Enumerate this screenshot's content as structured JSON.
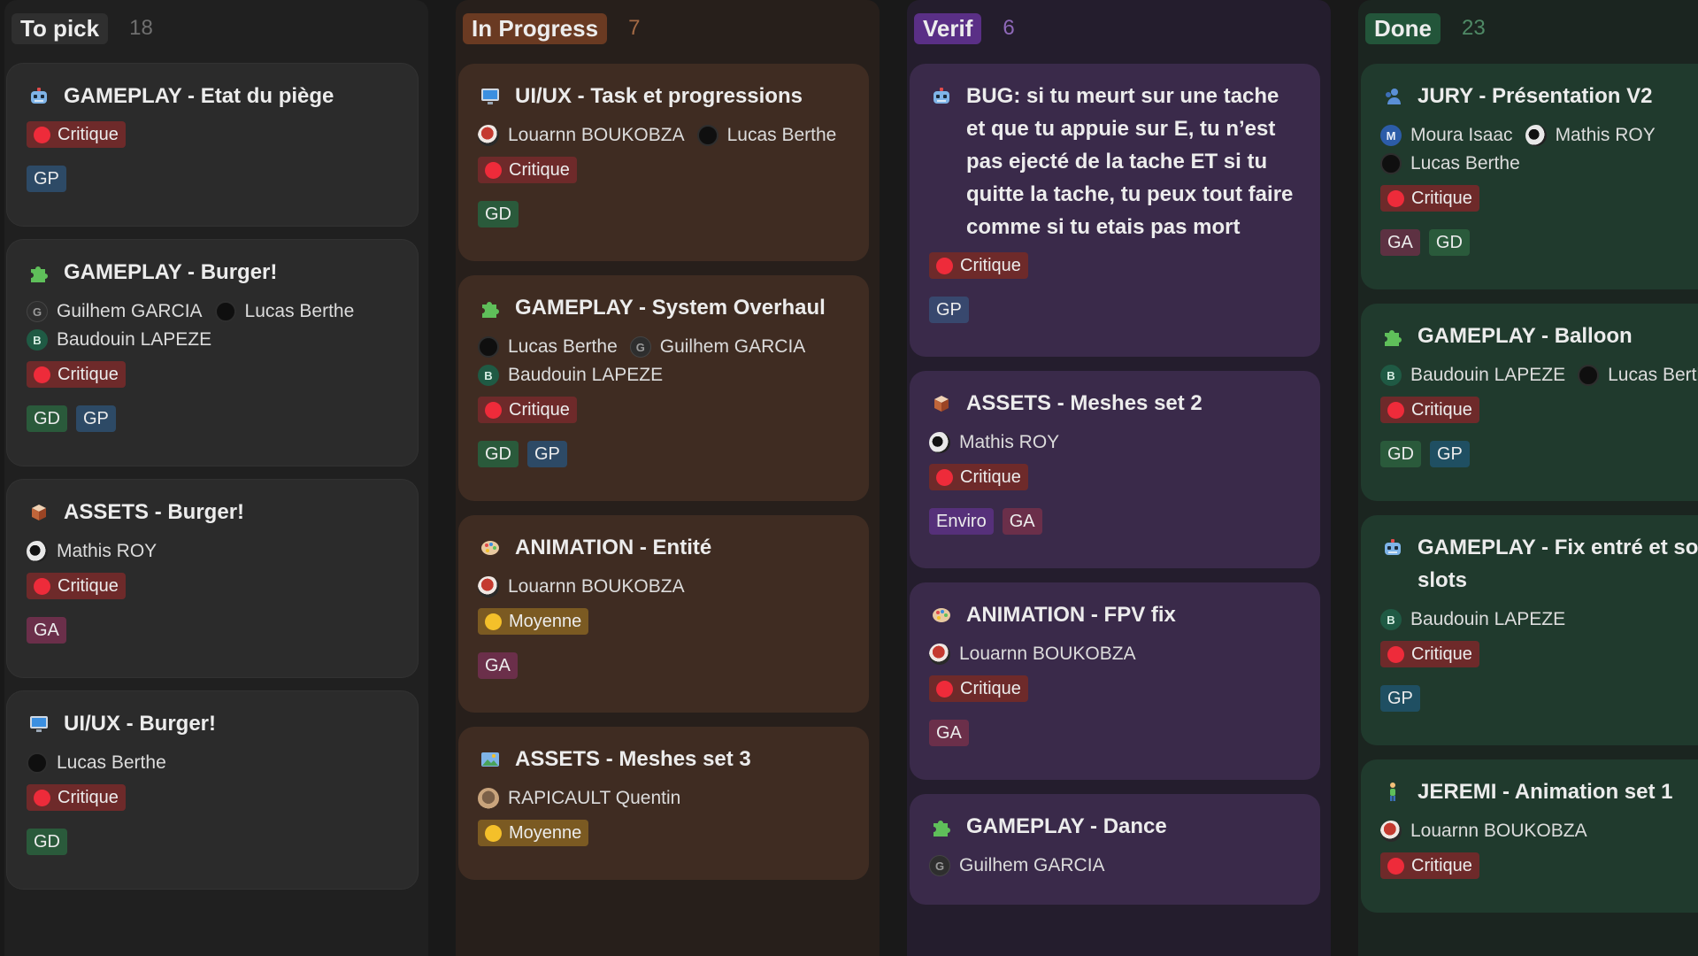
{
  "columns": [
    {
      "title": "To pick",
      "count": "18",
      "title_bg": "#2f2f2f",
      "count_color": "#6f6f6f",
      "cards": [
        {
          "title": "GAMEPLAY - Etat du piège",
          "icon": "robot-icon",
          "people": [],
          "priority": "Critique",
          "tags": [
            "GP"
          ]
        },
        {
          "title": "GAMEPLAY - Burger!",
          "icon": "puzzle-icon",
          "people": [
            {
              "name": "Guilhem GARCIA",
              "avatar": "letter-g",
              "initial": "G"
            },
            {
              "name": "Lucas Berthe",
              "avatar": "dark",
              "initial": ""
            },
            {
              "name": "Baudouin LAPEZE",
              "avatar": "letter-b",
              "initial": "B"
            }
          ],
          "priority": "Critique",
          "tags": [
            "GD",
            "GP"
          ]
        },
        {
          "title": "ASSETS - Burger!",
          "icon": "box-icon",
          "people": [
            {
              "name": "Mathis ROY",
              "avatar": "photo-bw",
              "initial": ""
            }
          ],
          "priority": "Critique",
          "tags": [
            "GA"
          ]
        },
        {
          "title": "UI/UX - Burger!",
          "icon": "monitor-icon",
          "people": [
            {
              "name": "Lucas Berthe",
              "avatar": "dark",
              "initial": ""
            }
          ],
          "priority": "Critique",
          "tags": [
            "GD"
          ]
        }
      ]
    },
    {
      "title": "In Progress",
      "count": "7",
      "title_bg": "#6a3a22",
      "count_color": "#a36a45",
      "cards": [
        {
          "title": "UI/UX - Task et progressions",
          "icon": "monitor-icon",
          "people": [
            {
              "name": "Louarnn BOUKOBZA",
              "avatar": "photo-red",
              "initial": ""
            },
            {
              "name": "Lucas Berthe",
              "avatar": "dark",
              "initial": ""
            }
          ],
          "priority": "Critique",
          "tags": [
            "GD"
          ]
        },
        {
          "title": "GAMEPLAY - System Overhaul",
          "icon": "puzzle-icon",
          "people": [
            {
              "name": "Lucas Berthe",
              "avatar": "dark",
              "initial": ""
            },
            {
              "name": "Guilhem GARCIA",
              "avatar": "letter-g",
              "initial": "G"
            },
            {
              "name": "Baudouin LAPEZE",
              "avatar": "letter-b",
              "initial": "B"
            }
          ],
          "priority": "Critique",
          "tags": [
            "GD",
            "GP"
          ]
        },
        {
          "title": "ANIMATION - Entité",
          "icon": "palette-icon",
          "people": [
            {
              "name": "Louarnn BOUKOBZA",
              "avatar": "photo-red",
              "initial": ""
            }
          ],
          "priority": "Moyenne",
          "tags": [
            "GA"
          ]
        },
        {
          "title": "ASSETS - Meshes set 3",
          "icon": "picture-icon",
          "people": [
            {
              "name": "RAPICAULT Quentin",
              "avatar": "photo-tan",
              "initial": ""
            }
          ],
          "priority": "Moyenne",
          "tags": []
        }
      ]
    },
    {
      "title": "Verif",
      "count": "6",
      "title_bg": "#5a2f86",
      "count_color": "#8e68b8",
      "cards": [
        {
          "title": "BUG: si tu meurt sur une tache et que tu appuie sur E, tu n’est pas ejecté de la tache ET si tu quitte la tache, tu peux tout faire comme si tu etais pas mort",
          "icon": "robot-icon",
          "people": [],
          "priority": "Critique",
          "tags": [
            "GP"
          ]
        },
        {
          "title": "ASSETS - Meshes set 2",
          "icon": "box-icon",
          "people": [
            {
              "name": "Mathis ROY",
              "avatar": "photo-bw",
              "initial": ""
            }
          ],
          "priority": "Critique",
          "tags": [
            "Enviro",
            "GA"
          ]
        },
        {
          "title": "ANIMATION - FPV fix",
          "icon": "palette-icon",
          "people": [
            {
              "name": "Louarnn BOUKOBZA",
              "avatar": "photo-red",
              "initial": ""
            }
          ],
          "priority": "Critique",
          "tags": [
            "GA"
          ]
        },
        {
          "title": "GAMEPLAY - Dance",
          "icon": "puzzle-icon",
          "people": [
            {
              "name": "Guilhem GARCIA",
              "avatar": "letter-g",
              "initial": "G"
            }
          ],
          "priority": "",
          "tags": []
        }
      ]
    },
    {
      "title": "Done",
      "count": "23",
      "title_bg": "#23553a",
      "count_color": "#4f8a66",
      "cards": [
        {
          "title": "JURY - Présentation V2",
          "icon": "person-icon",
          "people": [
            {
              "name": "Moura Isaac",
              "avatar": "letter-m",
              "initial": "M"
            },
            {
              "name": "Mathis ROY",
              "avatar": "photo-bw",
              "initial": ""
            },
            {
              "name": "Lucas Berthe",
              "avatar": "dark",
              "initial": ""
            }
          ],
          "priority": "Critique",
          "tags": [
            "GA",
            "GD"
          ]
        },
        {
          "title": "GAMEPLAY - Balloon",
          "icon": "puzzle-icon",
          "people": [
            {
              "name": "Baudouin LAPEZE",
              "avatar": "letter-b",
              "initial": "B"
            },
            {
              "name": "Lucas Berth",
              "avatar": "dark",
              "initial": ""
            }
          ],
          "priority": "Critique",
          "tags": [
            "GD",
            "GP"
          ]
        },
        {
          "title": "GAMEPLAY - Fix entré et sor des slots",
          "icon": "robot-icon",
          "people": [
            {
              "name": "Baudouin LAPEZE",
              "avatar": "letter-b",
              "initial": "B"
            }
          ],
          "priority": "Critique",
          "tags": [
            "GP"
          ]
        },
        {
          "title": "JEREMI - Animation set 1",
          "icon": "figure-icon",
          "people": [
            {
              "name": "Louarnn BOUKOBZA",
              "avatar": "photo-red",
              "initial": ""
            }
          ],
          "priority": "Critique",
          "tags": []
        }
      ]
    }
  ]
}
